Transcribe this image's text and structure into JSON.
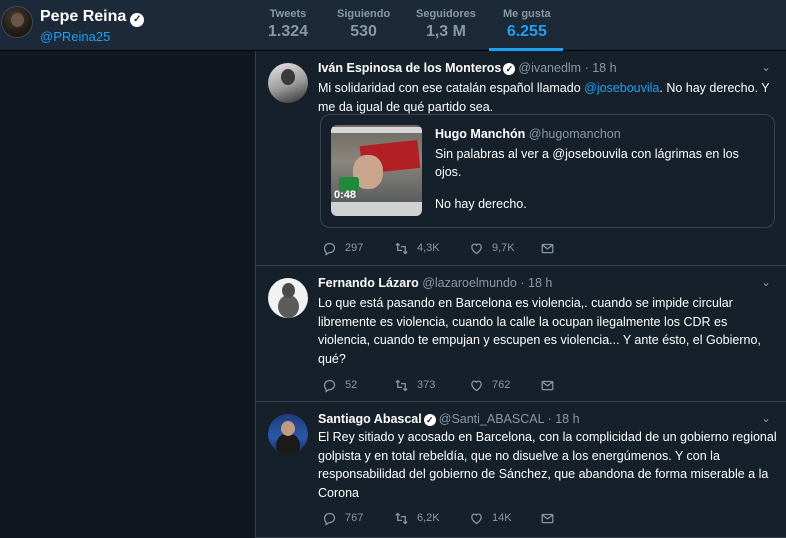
{
  "profile": {
    "name": "Pepe Reina",
    "handle": "@PReina25",
    "stats": [
      {
        "label": "Tweets",
        "value": "1.324"
      },
      {
        "label": "Siguiendo",
        "value": "530"
      },
      {
        "label": "Seguidores",
        "value": "1,3 M"
      },
      {
        "label": "Me gusta",
        "value": "6.255"
      }
    ],
    "active_tab": "Me gusta"
  },
  "tweets": [
    {
      "name": "Iván Espinosa de los Monteros",
      "handle": "@ivanedlm",
      "time": "18 h",
      "text_before": "Mi solidaridad con ese catalán español llamado ",
      "mention": "@josebouvila",
      "text_after": ". No hay derecho. Y me da igual de qué partido sea.",
      "quote": {
        "name": "Hugo Manchón",
        "handle": "@hugomanchon",
        "text1": "Sin palabras al ver a @josebouvila con lágrimas en los ojos.",
        "text2": "No hay derecho.",
        "video_duration": "0:48"
      },
      "replies": "297",
      "retweets": "4,3K",
      "likes": "9,7K"
    },
    {
      "name": "Fernando Lázaro",
      "handle": "@lazaroelmundo",
      "time": "18 h",
      "text": "Lo que está pasando en Barcelona es violencia,. cuando se impide circular libremente es violencia, cuando la calle la ocupan ilegalmente los CDR es violencia, cuando te empujan y escupen es violencia... Y ante ésto, el Gobierno, qué?",
      "replies": "52",
      "retweets": "373",
      "likes": "762"
    },
    {
      "name": "Santiago Abascal",
      "handle": "@Santi_ABASCAL",
      "time": "18 h",
      "text": "El Rey sitiado y acosado en Barcelona, con la complicidad de un gobierno regional golpista y en total rebeldía, que no disuelve a los energúmenos.  Y con la responsabilidad del gobierno de Sánchez, que abandona de forma miserable a la Corona",
      "replies": "767",
      "retweets": "6,2K",
      "likes": "14K"
    }
  ],
  "colors": {
    "accent": "#1da1f2",
    "background": "#15202b",
    "nav": "#1c2938",
    "secondary_text": "#8899a6"
  },
  "icons": [
    "verified-badge-icon",
    "caret-down-icon",
    "reply-icon",
    "retweet-icon",
    "like-icon",
    "direct-message-icon"
  ]
}
